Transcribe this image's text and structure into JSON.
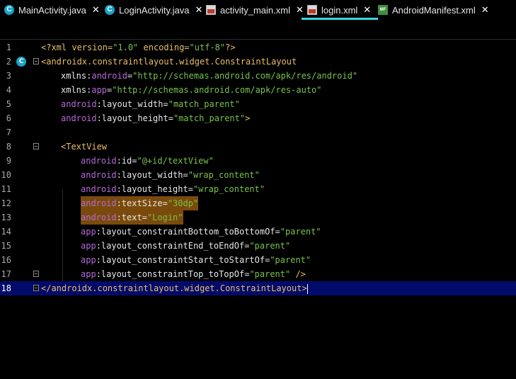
{
  "tabs": [
    {
      "label": "MainActivity.java",
      "icon": "class-c-icon"
    },
    {
      "label": "LoginActivity.java",
      "icon": "class-c-icon"
    },
    {
      "label": "activity_main.xml",
      "icon": "xml-file-icon"
    },
    {
      "label": "login.xml",
      "icon": "xml-file-icon",
      "active": true
    },
    {
      "label": "AndroidManifest.xml",
      "icon": "manifest-file-icon"
    }
  ],
  "close_glyph": "✕",
  "gutter_icon_letter": "C",
  "lines": {
    "l1": {
      "num": "1",
      "a": "<?xml version=",
      "b": "\"1.0\"",
      "c": " encoding=",
      "d": "\"utf-8\"",
      "e": "?>"
    },
    "l2": {
      "num": "2",
      "a": "<androidx.constraintlayout.widget.ConstraintLayout"
    },
    "l3": {
      "num": "3",
      "a": "xmlns:",
      "b": "android",
      "c": "=",
      "d": "\"http://schemas.android.com/apk/res/android\""
    },
    "l4": {
      "num": "4",
      "a": "xmlns:",
      "b": "app",
      "c": "=",
      "d": "\"http://schemas.android.com/apk/res-auto\""
    },
    "l5": {
      "num": "5",
      "a": "android",
      "b": ":layout_width=",
      "c": "\"match_parent\""
    },
    "l6": {
      "num": "6",
      "a": "android",
      "b": ":layout_height=",
      "c": "\"match_parent\"",
      "d": ">"
    },
    "l7": {
      "num": "7"
    },
    "l8": {
      "num": "8",
      "a": "<TextView"
    },
    "l9": {
      "num": "9",
      "a": "android",
      "b": ":id=",
      "c": "\"@+id/textView\""
    },
    "l10": {
      "num": "10",
      "a": "android",
      "b": ":layout_width=",
      "c": "\"wrap_content\""
    },
    "l11": {
      "num": "11",
      "a": "android",
      "b": ":layout_height=",
      "c": "\"wrap_content\""
    },
    "l12": {
      "num": "12",
      "a": "android",
      "b": ":textSize=",
      "c": "\"30dp\""
    },
    "l13": {
      "num": "13",
      "a": "android",
      "b": ":text=",
      "c": "\"Login\""
    },
    "l14": {
      "num": "14",
      "a": "app",
      "b": ":layout_constraintBottom_toBottomOf=",
      "c": "\"parent\""
    },
    "l15": {
      "num": "15",
      "a": "app",
      "b": ":layout_constraintEnd_toEndOf=",
      "c": "\"parent\""
    },
    "l16": {
      "num": "16",
      "a": "app",
      "b": ":layout_constraintStart_toStartOf=",
      "c": "\"parent\""
    },
    "l17": {
      "num": "17",
      "a": "app",
      "b": ":layout_constraintTop_toTopOf=",
      "c": "\"parent\"",
      "d": " />"
    },
    "l18": {
      "num": "18",
      "a": "</androidx.constraintlayout.widget.ConstraintLayout>"
    }
  },
  "colors": {
    "tag": "#e8bf6a",
    "namespace": "#b46ad8",
    "value": "#79c24a",
    "text": "#e6e6e6",
    "current_line": "#020a6a",
    "highlight": "#7a4a0c",
    "active_tab_underline": "#3fd4e3"
  }
}
